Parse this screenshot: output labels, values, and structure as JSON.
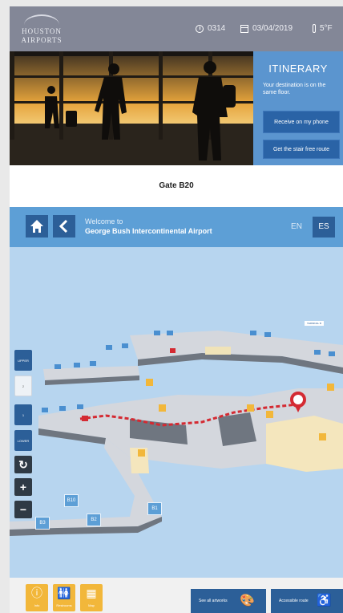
{
  "header": {
    "logo_line1": "HOUSTON",
    "logo_line2": "AIRPORTS",
    "time": "0314",
    "date": "03/04/2019",
    "temperature": "5°F"
  },
  "itinerary": {
    "title": "ITINERARY",
    "message": "Your destination is on the same floor.",
    "receive_button": "Receive on my phone",
    "stair_button": "Get the stair free route"
  },
  "destination": {
    "label": "Gate B20"
  },
  "map_header": {
    "welcome_line1": "Welcome to",
    "welcome_line2": "George Bush Intercontinental Airport",
    "lang_en": "EN",
    "lang_es": "ES"
  },
  "map": {
    "terminal_tag": "TERMINAL B",
    "gate_labels": [
      "B10",
      "B2",
      "B1",
      "B3"
    ],
    "floor_buttons": [
      "UPPER",
      "2",
      "1",
      "LOWER"
    ]
  },
  "bottom": {
    "info_label": "Info",
    "restrooms_label": "Restrooms",
    "map_label": "Map",
    "see_artworks": "See all artworks",
    "accessible_route": "Accessible route"
  },
  "colors": {
    "header_bg": "#838797",
    "accent_blue": "#5d9fd6",
    "dark_blue": "#2c5f98",
    "map_bg": "#b7d5ef",
    "route_red": "#d42a32",
    "amenity_yellow": "#f2b73a"
  }
}
